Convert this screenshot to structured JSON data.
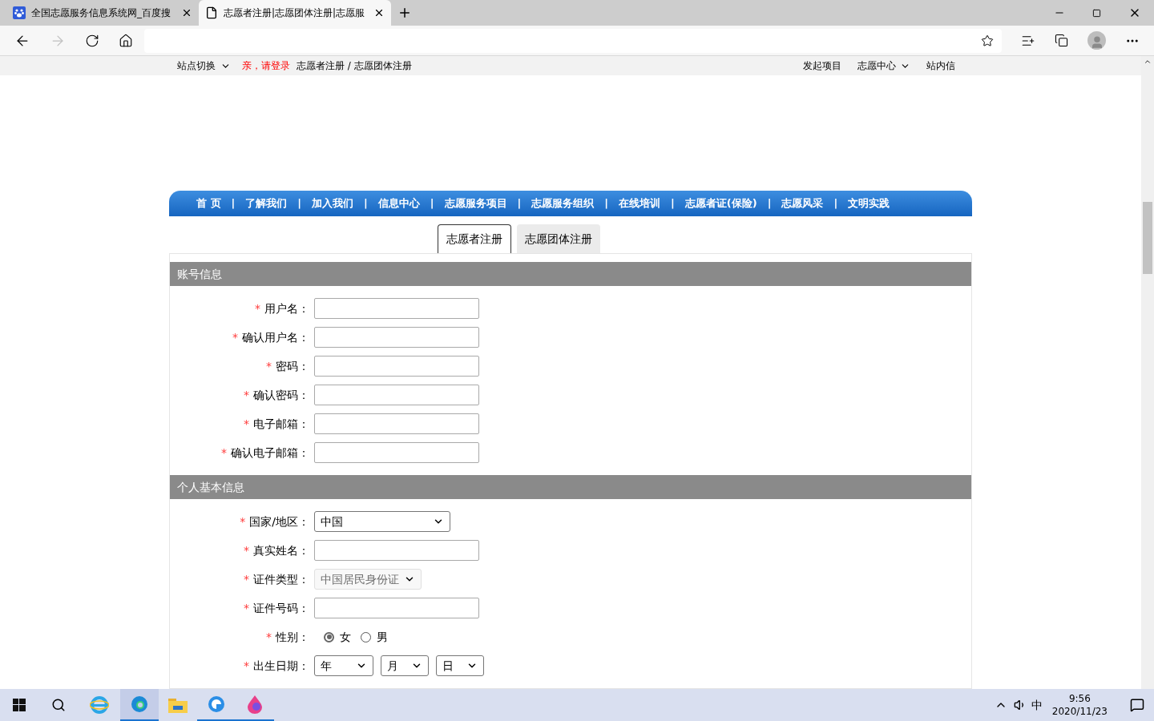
{
  "browser": {
    "tabs": [
      {
        "title": "全国志愿服务信息系统网_百度搜",
        "kind": "paw",
        "selected": false
      },
      {
        "title": "志愿者注册|志愿团体注册|志愿服",
        "kind": "page",
        "selected": true
      }
    ]
  },
  "site_bar": {
    "switch": {
      "label": "站点切换",
      "dropdown": true
    },
    "login": "亲，请登录",
    "register": "志愿者注册 / 志愿团体注册",
    "links": [
      {
        "label": "发起项目",
        "dropdown": false
      },
      {
        "label": "志愿中心",
        "dropdown": true
      },
      {
        "label": "站内信",
        "dropdown": false
      }
    ]
  },
  "nav": [
    "首 页",
    "了解我们",
    "加入我们",
    "信息中心",
    "志愿服务项目",
    "志愿服务组织",
    "在线培训",
    "志愿者证(保险)",
    "志愿风采",
    "文明实践"
  ],
  "nav_separator": "|",
  "reg_tabs": [
    {
      "label": "志愿者注册",
      "selected": true
    },
    {
      "label": "志愿团体注册",
      "selected": false
    }
  ],
  "sections": [
    {
      "title": "账号信息",
      "fields": [
        {
          "kind": "text",
          "mark": "*",
          "label": "用户名："
        },
        {
          "kind": "text",
          "mark": "*",
          "label": "确认用户名："
        },
        {
          "kind": "text",
          "mark": "*",
          "label": "密码："
        },
        {
          "kind": "text",
          "mark": "*",
          "label": "确认密码："
        },
        {
          "kind": "text",
          "mark": "*",
          "label": "电子邮箱："
        },
        {
          "kind": "text",
          "mark": "*",
          "label": "确认电子邮箱："
        }
      ]
    },
    {
      "title": "个人基本信息",
      "fields": [
        {
          "kind": "select",
          "mark": "*",
          "label": "国家/地区：",
          "value": "中国",
          "disabled": false
        },
        {
          "kind": "text",
          "mark": "*",
          "label": "真实姓名："
        },
        {
          "kind": "select",
          "mark": "*",
          "label": "证件类型：",
          "value": "中国居民身份证",
          "disabled": true
        },
        {
          "kind": "text",
          "mark": "*",
          "label": "证件号码："
        },
        {
          "kind": "radio",
          "mark": "*",
          "label": "性别：",
          "options": [
            {
              "label": "女",
              "selected": true
            },
            {
              "label": "男",
              "selected": false
            }
          ]
        },
        {
          "kind": "date",
          "mark": "*",
          "label": "出生日期：",
          "parts": [
            "年",
            "月",
            "日"
          ]
        }
      ]
    }
  ],
  "taskbar": {
    "ime": "中",
    "time": "9:56",
    "date": "2020/11/23"
  }
}
